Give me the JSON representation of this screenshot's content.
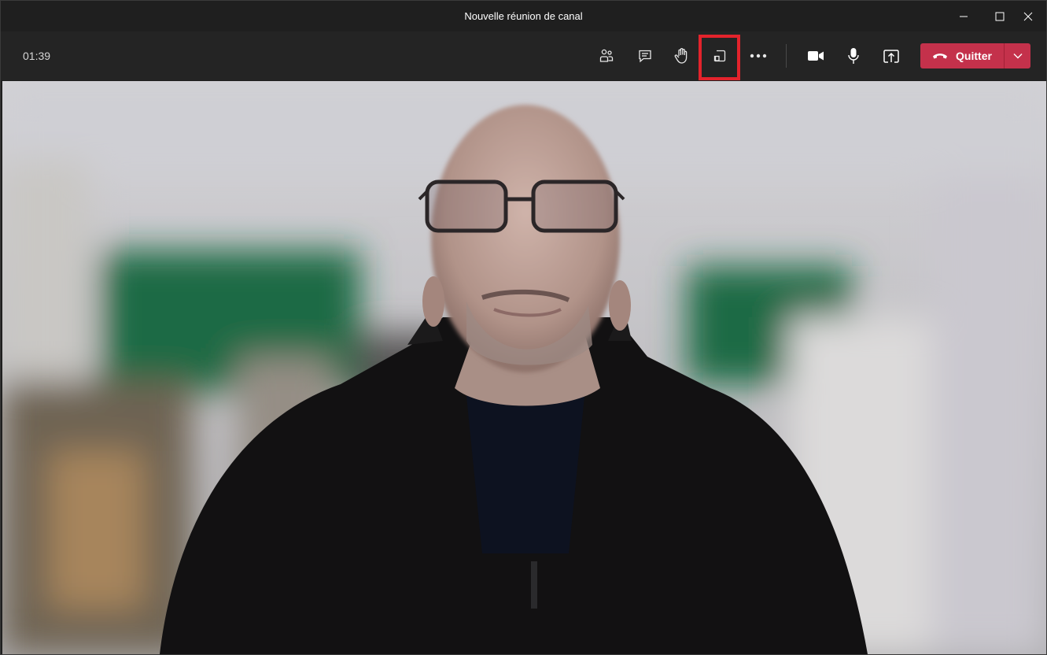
{
  "window": {
    "title": "Nouvelle réunion de canal",
    "controls": [
      "minimize-icon",
      "maximize-icon",
      "close-icon"
    ]
  },
  "toolbar": {
    "timer": "01:39",
    "buttons": [
      {
        "name": "participants-button",
        "icon": "participants-icon"
      },
      {
        "name": "chat-button",
        "icon": "chat-icon"
      },
      {
        "name": "raise-hand-button",
        "icon": "raise-hand-icon"
      },
      {
        "name": "breakout-rooms-button",
        "icon": "breakout-rooms-icon",
        "highlighted": true
      },
      {
        "name": "more-actions-button",
        "icon": "more-icon"
      },
      {
        "name": "camera-button",
        "icon": "camera-icon"
      },
      {
        "name": "microphone-button",
        "icon": "microphone-icon"
      },
      {
        "name": "share-screen-button",
        "icon": "share-icon"
      }
    ],
    "leave": {
      "label": "Quitter",
      "icon": "phone-hangup-icon",
      "dropdown_icon": "chevron-down-icon"
    }
  },
  "video": {
    "content": "participant-camera-feed"
  },
  "colors": {
    "titlebar": "#1f1f1f",
    "toolbar": "#242424",
    "leave_button": "#c4314b",
    "highlight_border": "#e3232c"
  }
}
